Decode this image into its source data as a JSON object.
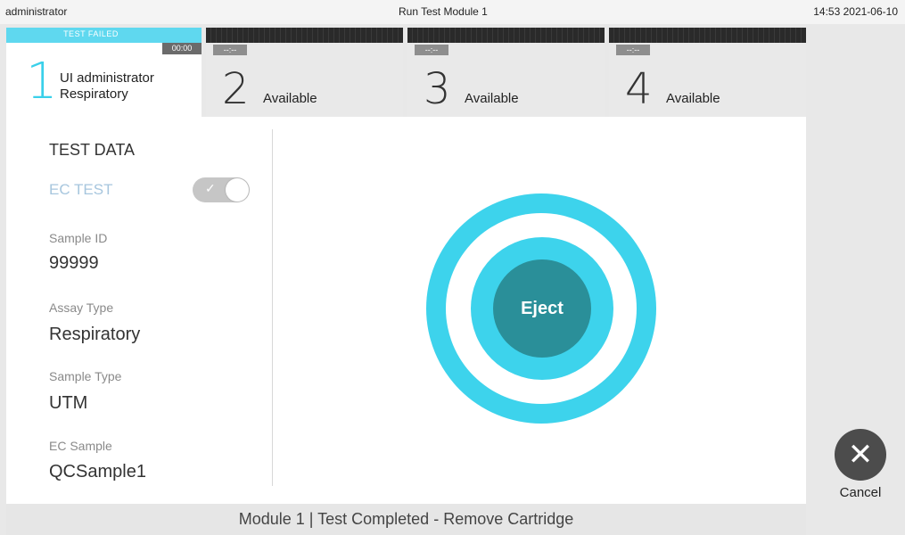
{
  "topbar": {
    "user": "administrator",
    "title": "Run Test Module 1",
    "clock": "14:53 2021-06-10"
  },
  "tabs": [
    {
      "status": "TEST FAILED",
      "time": "00:00",
      "number": "1",
      "line1": "UI administrator",
      "line2": "Respiratory"
    },
    {
      "time": "--:--",
      "number": "2",
      "label": "Available"
    },
    {
      "time": "--:--",
      "number": "3",
      "label": "Available"
    },
    {
      "time": "--:--",
      "number": "4",
      "label": "Available"
    }
  ],
  "test_data": {
    "title": "TEST DATA",
    "ec_test_label": "EC TEST",
    "ec_test_toggle": {
      "on": true,
      "check_glyph": "✓"
    },
    "fields": [
      {
        "label": "Sample ID",
        "value": "99999"
      },
      {
        "label": "Assay Type",
        "value": "Respiratory"
      },
      {
        "label": "Sample Type",
        "value": "UTM"
      },
      {
        "label": "EC Sample",
        "value": "QCSample1"
      }
    ]
  },
  "eject": {
    "label": "Eject",
    "colors": {
      "ring": "#3dd3ec",
      "core": "#2a8f99"
    }
  },
  "cancel": {
    "label": "Cancel",
    "icon": "close-icon",
    "glyph": "✕"
  },
  "footer": {
    "status": "Module 1  |  Test Completed - Remove Cartridge"
  },
  "colors": {
    "accent": "#3ad0ea",
    "failed_strip": "#5fd8ef"
  }
}
